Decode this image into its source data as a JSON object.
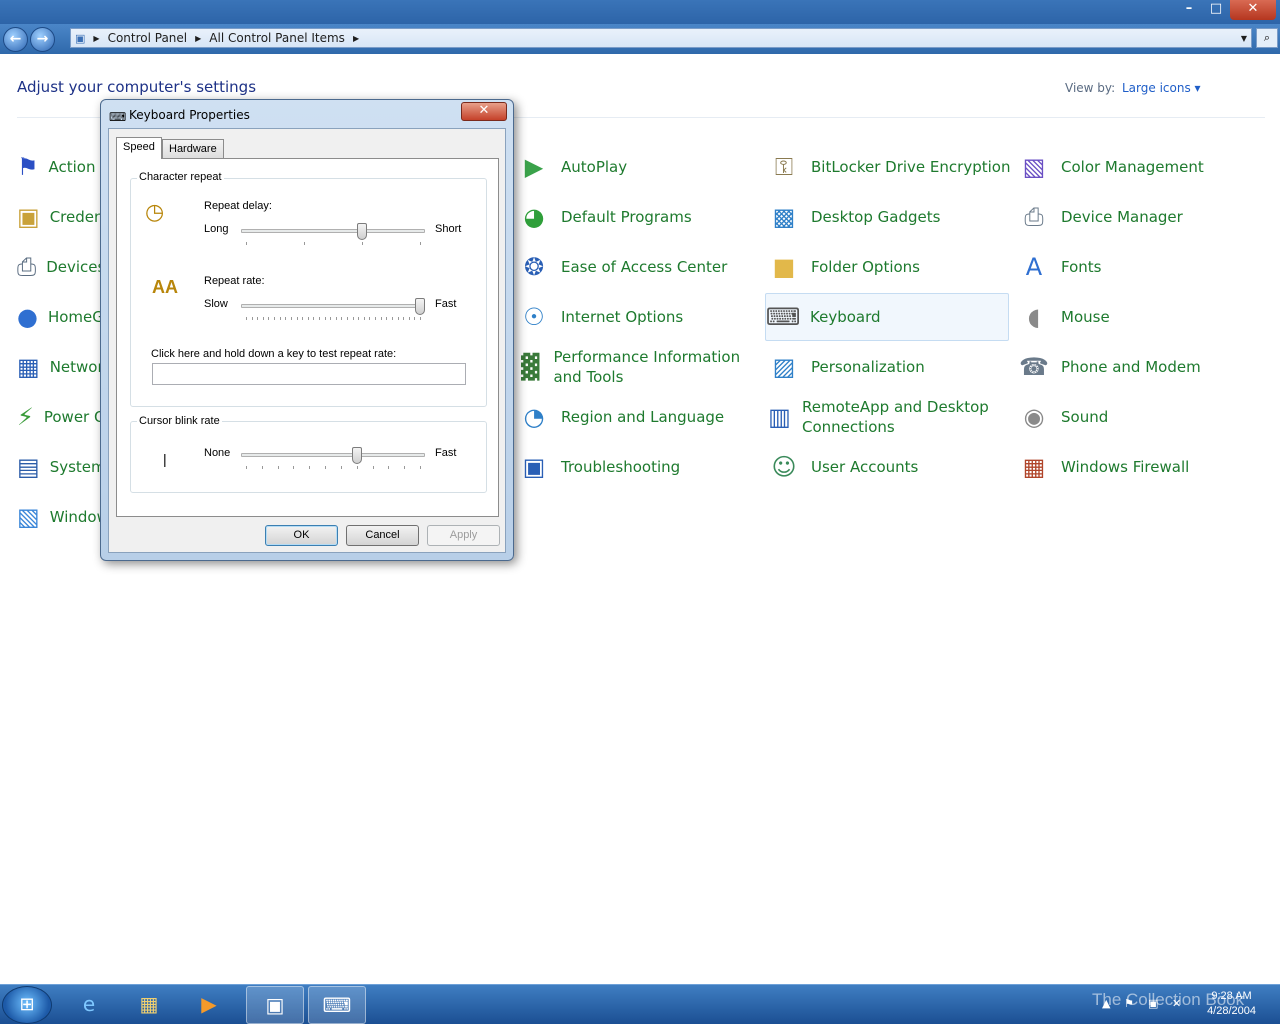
{
  "window": {
    "minimize": "–",
    "maximize": "□",
    "close": "✕"
  },
  "nav": {
    "back": "←",
    "forward": "→",
    "breadcrumb": [
      "Control Panel",
      "All Control Panel Items"
    ],
    "search_glyph": "⌕"
  },
  "header": {
    "title": "Adjust your computer's settings",
    "view_by_label": "View by:",
    "view_by_value": "Large icons ▾"
  },
  "items": [
    {
      "label": "Action Center",
      "icon": "⚑",
      "color": "#2b4fc4"
    },
    {
      "label": "Credential Manager",
      "icon": "▣",
      "color": "#c9a23a"
    },
    {
      "label": "Devices and Printers",
      "icon": "⎙",
      "color": "#5a6c80"
    },
    {
      "label": "HomeGroup",
      "icon": "●",
      "color": "#2f6fd1"
    },
    {
      "label": "Network and Sharing Center",
      "icon": "▦",
      "color": "#2a5fb5"
    },
    {
      "label": "Power Options",
      "icon": "⚡",
      "color": "#3a9b3a"
    },
    {
      "label": "System",
      "icon": "▤",
      "color": "#2b5ca8"
    },
    {
      "label": "Windows Update",
      "icon": "▧",
      "color": "#3a86d8"
    },
    {
      "label": "AutoPlay",
      "icon": "▶",
      "color": "#3aa24a"
    },
    {
      "label": "Default Programs",
      "icon": "◕",
      "color": "#2f9f3a"
    },
    {
      "label": "Ease of Access Center",
      "icon": "❂",
      "color": "#2a5fb5"
    },
    {
      "label": "Internet Options",
      "icon": "☉",
      "color": "#2f80c8"
    },
    {
      "label": "Performance Information and Tools",
      "icon": "▓",
      "color": "#3a7a3a"
    },
    {
      "label": "Region and Language",
      "icon": "◔",
      "color": "#2f80c8"
    },
    {
      "label": "Troubleshooting",
      "icon": "▣",
      "color": "#2a5fb5"
    },
    {
      "label": "BitLocker Drive Encryption",
      "icon": "⚿",
      "color": "#8a7a50"
    },
    {
      "label": "Desktop Gadgets",
      "icon": "▩",
      "color": "#2f80c8"
    },
    {
      "label": "Folder Options",
      "icon": "■",
      "color": "#e2b84a"
    },
    {
      "label": "Keyboard",
      "icon": "⌨",
      "color": "#555555"
    },
    {
      "label": "Personalization",
      "icon": "▨",
      "color": "#2f80c8"
    },
    {
      "label": "RemoteApp and Desktop Connections",
      "icon": "▥",
      "color": "#2a5fb5"
    },
    {
      "label": "User Accounts",
      "icon": "☺",
      "color": "#3a8a5a"
    },
    {
      "label": "Color Management",
      "icon": "▧",
      "color": "#6a4fc4"
    },
    {
      "label": "Device Manager",
      "icon": "⎙",
      "color": "#6a7a8a"
    },
    {
      "label": "Fonts",
      "icon": "A",
      "color": "#2f6fd1"
    },
    {
      "label": "Mouse",
      "icon": "◖",
      "color": "#8a8a8a"
    },
    {
      "label": "Phone and Modem",
      "icon": "☎",
      "color": "#6a7a8a"
    },
    {
      "label": "Sound",
      "icon": "◉",
      "color": "#8a8a8a"
    },
    {
      "label": "Windows Firewall",
      "icon": "▦",
      "color": "#b0452a"
    }
  ],
  "dialog": {
    "title": "Keyboard Properties",
    "close": "✕",
    "tabs": [
      "Speed",
      "Hardware"
    ],
    "char_repeat_group": "Character repeat",
    "repeat_delay_label": "Repeat delay:",
    "repeat_delay_min": "Long",
    "repeat_delay_max": "Short",
    "repeat_delay_value_fraction": 0.667,
    "repeat_rate_label": "Repeat rate:",
    "repeat_rate_min": "Slow",
    "repeat_rate_max": "Fast",
    "repeat_rate_value_fraction": 1.0,
    "test_label": "Click here and hold down a key to test repeat rate:",
    "test_value": "",
    "cursor_group": "Cursor blink rate",
    "cursor_min": "None",
    "cursor_max": "Fast",
    "cursor_value_fraction": 0.636,
    "cursor_glyph": "|",
    "ok": "OK",
    "cancel": "Cancel",
    "apply": "Apply"
  },
  "taskbar": {
    "start_glyph": "⊞",
    "watermark": "The Collection Book",
    "time": "9:28 AM",
    "date": "4/28/2004"
  }
}
